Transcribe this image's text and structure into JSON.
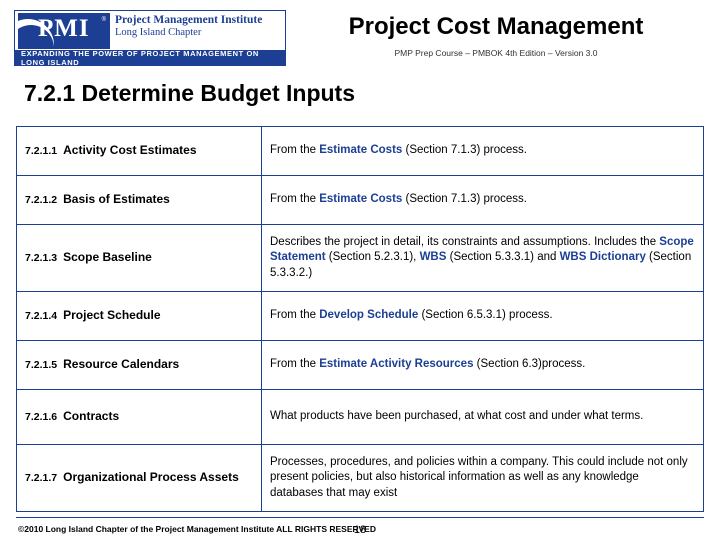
{
  "header": {
    "logo": {
      "mark_text": "PMI",
      "registered_mark": "®",
      "line1": "Project Management Institute",
      "line2": "Long Island Chapter",
      "tagline": "EXPANDING THE POWER OF PROJECT MANAGEMENT ON LONG ISLAND"
    },
    "title": "Project Cost Management",
    "subtitle": "PMP Prep Course – PMBOK 4th Edition – Version 3.0"
  },
  "slide": {
    "heading": "7.2.1 Determine Budget Inputs"
  },
  "table": {
    "rows": [
      {
        "num": "7.2.1.1",
        "label": "Activity Cost Estimates",
        "desc_pre": "From the ",
        "desc_hl": "Estimate Costs",
        "desc_post": " (Section 7.1.3) process."
      },
      {
        "num": "7.2.1.2",
        "label": "Basis of Estimates",
        "desc_pre": "From the ",
        "desc_hl": "Estimate Costs",
        "desc_post": " (Section 7.1.3) process."
      },
      {
        "num": "7.2.1.3",
        "label": "Scope Baseline",
        "desc_pre": "Describes the project in detail, its constraints and assumptions. Includes the ",
        "desc_hl": "Scope Statement",
        "desc_mid": " (Section 5.2.3.1), ",
        "desc_hl2": "WBS",
        "desc_mid2": " (Section 5.3.3.1)  and ",
        "desc_hl3": "WBS Dictionary",
        "desc_post": " (Section 5.3.3.2.)"
      },
      {
        "num": "7.2.1.4",
        "label": "Project Schedule",
        "desc_pre": "From the ",
        "desc_hl": "Develop Schedule",
        "desc_post": " (Section 6.5.3.1) process."
      },
      {
        "num": "7.2.1.5",
        "label": "Resource Calendars",
        "desc_pre": "From the ",
        "desc_hl": "Estimate Activity Resources",
        "desc_post": " (Section 6.3)process."
      },
      {
        "num": "7.2.1.6",
        "label": "Contracts",
        "desc_pre": "What products have been purchased, at what cost and under what terms.",
        "desc_hl": "",
        "desc_post": ""
      },
      {
        "num": "7.2.1.7",
        "label": "Organizational Process Assets",
        "desc_pre": "Processes, procedures, and policies within a company. This could include not only present policies, but also historical information as well as any knowledge databases that may exist",
        "desc_hl": "",
        "desc_post": ""
      }
    ]
  },
  "footer": {
    "copyright": "©2010 Long Island Chapter of the Project Management Institute  ALL RIGHTS RESERVED",
    "page_number": "18"
  },
  "colors": {
    "accent": "#1c3f94",
    "text": "#000000",
    "background": "#ffffff"
  }
}
